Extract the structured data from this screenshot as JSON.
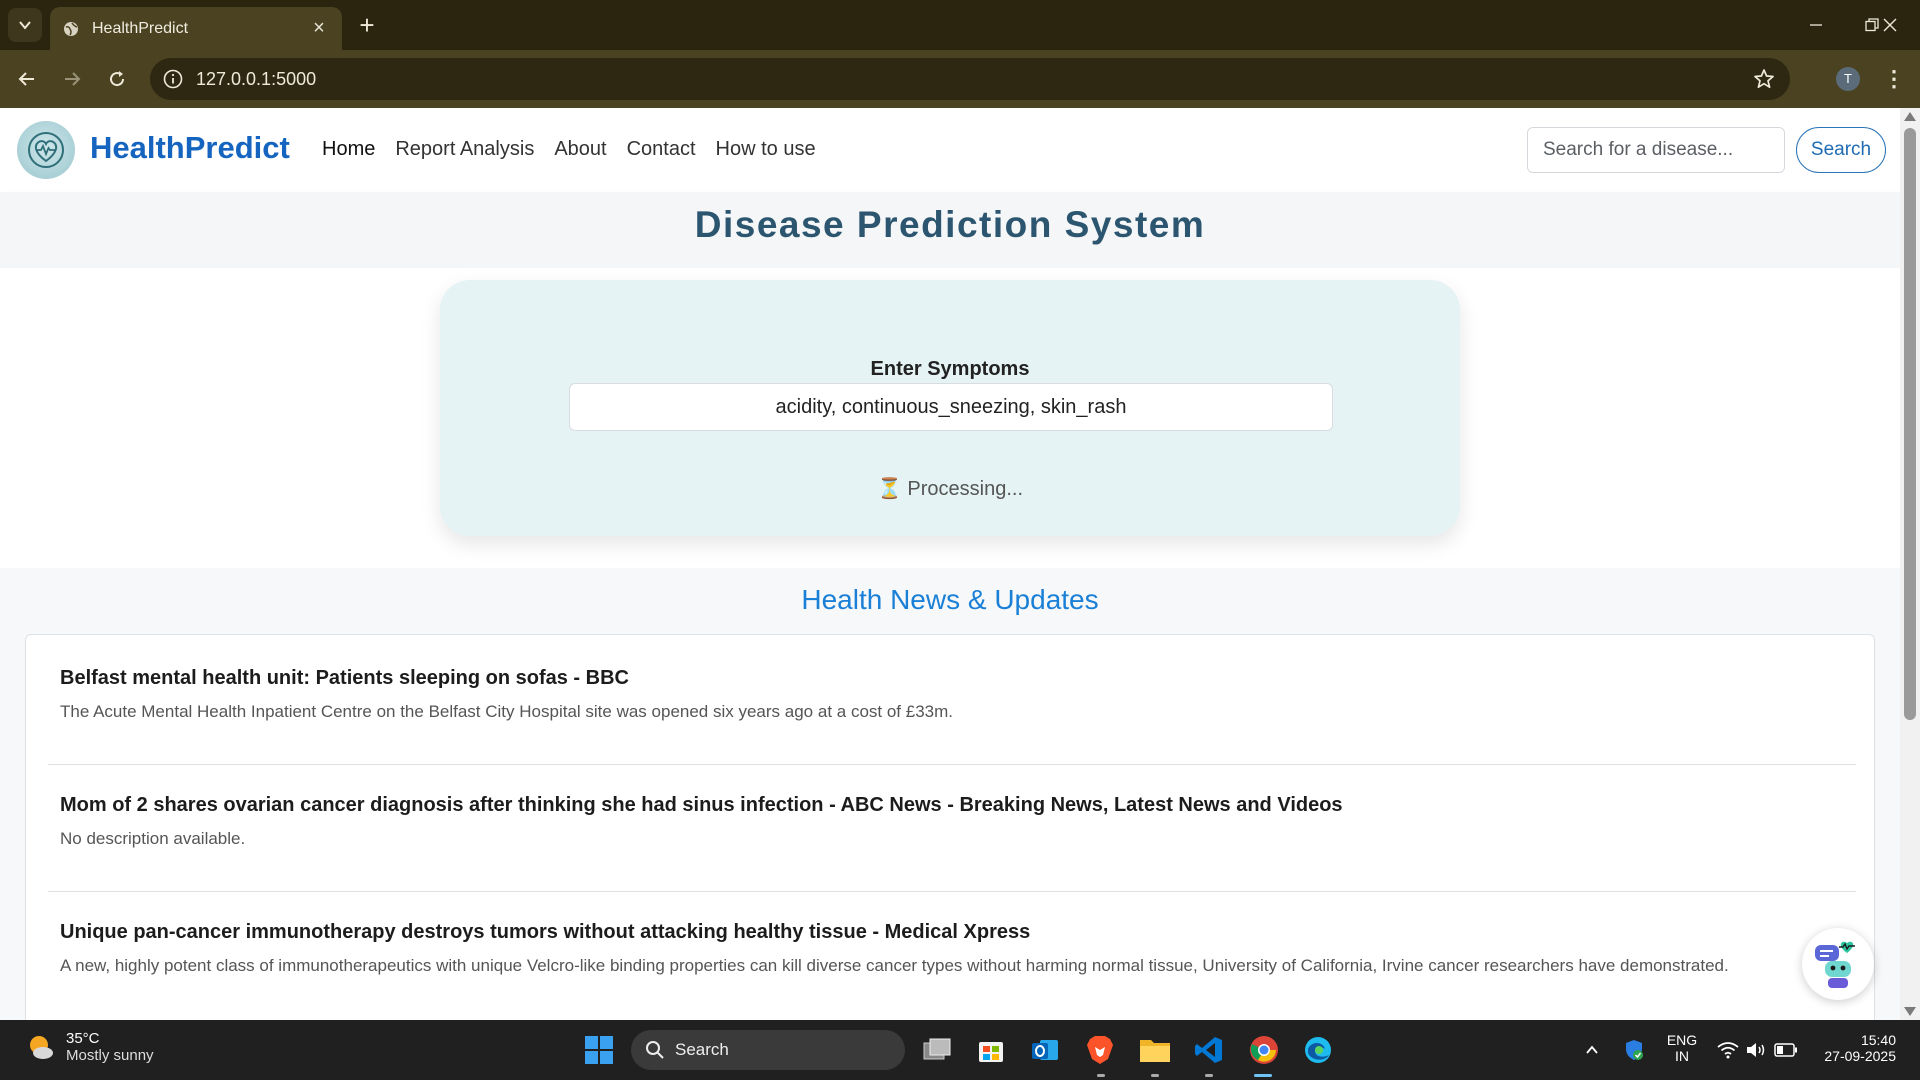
{
  "browser": {
    "tab_title": "HealthPredict",
    "url": "127.0.0.1:5000",
    "profile_initial": "T"
  },
  "site": {
    "brand": "HealthPredict",
    "nav": [
      "Home",
      "Report Analysis",
      "About",
      "Contact",
      "How to use"
    ],
    "search_placeholder": "Search for a disease...",
    "search_button": "Search"
  },
  "main": {
    "heading": "Disease Prediction System",
    "symptoms_label": "Enter Symptoms",
    "symptoms_value": "acidity, continuous_sneezing, skin_rash",
    "status_icon": "⏳",
    "status_text": "Processing..."
  },
  "news": {
    "section_title": "Health News & Updates",
    "items": [
      {
        "title": "Belfast mental health unit: Patients sleeping on sofas - BBC",
        "description": "The Acute Mental Health Inpatient Centre on the Belfast City Hospital site was opened six years ago at a cost of £33m."
      },
      {
        "title": "Mom of 2 shares ovarian cancer diagnosis after thinking she had sinus infection - ABC News - Breaking News, Latest News and Videos",
        "description": "No description available."
      },
      {
        "title": "Unique pan-cancer immunotherapy destroys tumors without attacking healthy tissue - Medical Xpress",
        "description": "A new, highly potent class of immunotherapeutics with unique Velcro-like binding properties can kill diverse cancer types without harming normal tissue, University of California, Irvine cancer researchers have demonstrated."
      }
    ]
  },
  "taskbar": {
    "weather_temp": "35°C",
    "weather_condition": "Mostly sunny",
    "search_label": "Search",
    "lang_line1": "ENG",
    "lang_line2": "IN",
    "time": "15:40",
    "date": "27-09-2025"
  },
  "colors": {
    "brand": "#1565c0",
    "heading": "#2c5570",
    "news_title": "#1a7fd6",
    "card_bg": "#e5f3f4"
  }
}
